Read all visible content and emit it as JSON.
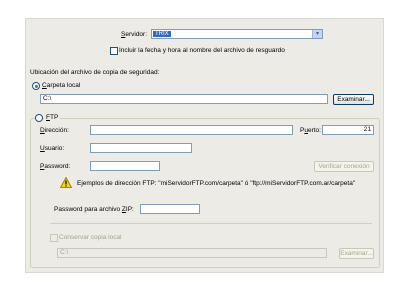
{
  "server": {
    "label": "Servidor:",
    "value": "TRIX",
    "arrow_icon": "chevron-down-icon"
  },
  "include_date": {
    "label": "Incluir la fecha y hora al nombre del archivo de resguardo",
    "checked": false
  },
  "location": {
    "heading": "Ubicación del archivo de copia de seguridad:",
    "local": {
      "label": "Carpeta local",
      "selected": true,
      "path": "C:\\",
      "browse_label": "Examinar..."
    },
    "ftp": {
      "label": "FTP",
      "selected": false,
      "address_label": "Dirección:",
      "address_value": "",
      "port_label": "Puerto:",
      "port_value": "21",
      "user_label": "Usuario:",
      "user_value": "",
      "password_label": "Password:",
      "password_value": "",
      "verify_label": "Verificar conexión",
      "hint": "Ejemplos de dirección FTP: \"miServidorFTP.com/carpeta\" ó \"ftp://miServidorFTP.com.ar/carpeta\"",
      "zip_label": "Password  para archivo ZIP:",
      "zip_value": "",
      "keep_local_label": "Conservar copia local",
      "keep_local_path": "C:\\",
      "keep_local_browse": "Examinar..."
    }
  },
  "colors": {
    "panel": "#ecebe6",
    "selection": "#316ac5",
    "warning": "#f5d20a"
  }
}
